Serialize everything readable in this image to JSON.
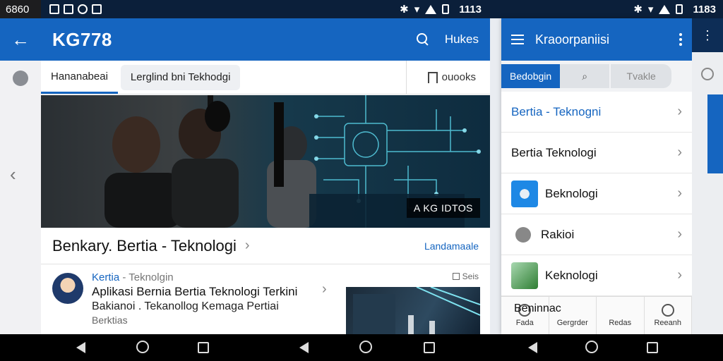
{
  "status": {
    "left_label": "6860",
    "main_time": "1113",
    "right_time": "1183"
  },
  "main": {
    "title": "KG778",
    "action_label": "Hukes",
    "tabs": [
      {
        "label": "Hananabeai"
      },
      {
        "label": "Lerglind bni Tekhodgi"
      }
    ],
    "tab_right_label": "ouooks",
    "hero_badge": "A KG IDTOS",
    "section_title": "Benkary.  Bertia - Teknologi",
    "section_link": "Landamaale",
    "article": {
      "category": "Kertia",
      "category_sub": "- Teknolgin",
      "title": "Aplikasi Bernia Bertia Teknologi Terkini",
      "subtitle": "Bakianoi . Tekanollog Kemaga Pertiai",
      "tag": "Berktias",
      "meta": "Seis"
    }
  },
  "right_panel": {
    "title": "Kraoorpaniisi",
    "tabs": [
      {
        "label": "Bedobgin"
      },
      {
        "label": "Tvakle"
      }
    ],
    "items": [
      {
        "label": "Bertia - Teknogni"
      },
      {
        "label": "Bertia Teknologi"
      },
      {
        "label": "Beknologi"
      },
      {
        "label": "Rakioi"
      },
      {
        "label": "Keknologi"
      }
    ],
    "bottom_overlay": "Beninnac",
    "bottom_nav": [
      {
        "label": "Fada"
      },
      {
        "label": "Gergrder"
      },
      {
        "label": "Redas"
      },
      {
        "label": "Reeanh"
      }
    ]
  },
  "colors": {
    "primary": "#1565c0",
    "status_bar": "#0b1f3a"
  }
}
